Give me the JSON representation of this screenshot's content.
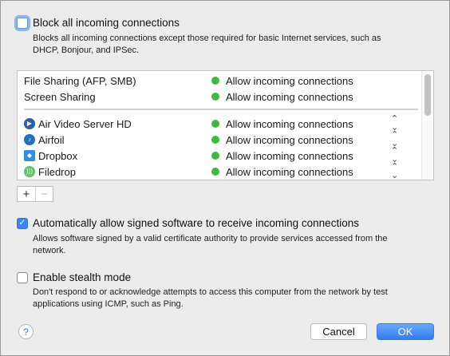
{
  "block_all": {
    "label": "Block all incoming connections",
    "checked": false,
    "description_line1": "Blocks all incoming connections except those required for basic Internet services,  such as",
    "description_line2": "DHCP, Bonjour, and IPSec."
  },
  "services": [
    {
      "name": "File Sharing (AFP, SMB)",
      "status": "Allow incoming connections"
    },
    {
      "name": "Screen Sharing",
      "status": "Allow incoming connections"
    }
  ],
  "apps": [
    {
      "name": "Air Video Server HD",
      "icon": "air-video-icon",
      "status": "Allow incoming connections",
      "icon_color": "#2b5ea8"
    },
    {
      "name": "Airfoil",
      "icon": "airfoil-icon",
      "status": "Allow incoming connections",
      "icon_color": "#1f6fc2"
    },
    {
      "name": "Dropbox",
      "icon": "dropbox-icon",
      "status": "Allow incoming connections",
      "icon_color": "#2f8ee8"
    },
    {
      "name": "Filedrop",
      "icon": "filedrop-icon",
      "status": "Allow incoming connections",
      "icon_color": "#5cc46b"
    }
  ],
  "list_controls": {
    "add": "+",
    "remove": "−"
  },
  "auto_allow": {
    "label": "Automatically allow signed software to receive incoming connections",
    "checked": true,
    "description_line1": "Allows software signed by a valid certificate authority to provide services accessed from the",
    "description_line2": "network."
  },
  "stealth": {
    "label": "Enable stealth mode",
    "checked": false,
    "description_line1": "Don't respond to or acknowledge attempts to access this computer from the network by test",
    "description_line2": "applications using ICMP, such as Ping."
  },
  "help_label": "?",
  "cancel_label": "Cancel",
  "ok_label": "OK",
  "colors": {
    "accent": "#3b86f7",
    "status_green": "#3fbb3b"
  }
}
